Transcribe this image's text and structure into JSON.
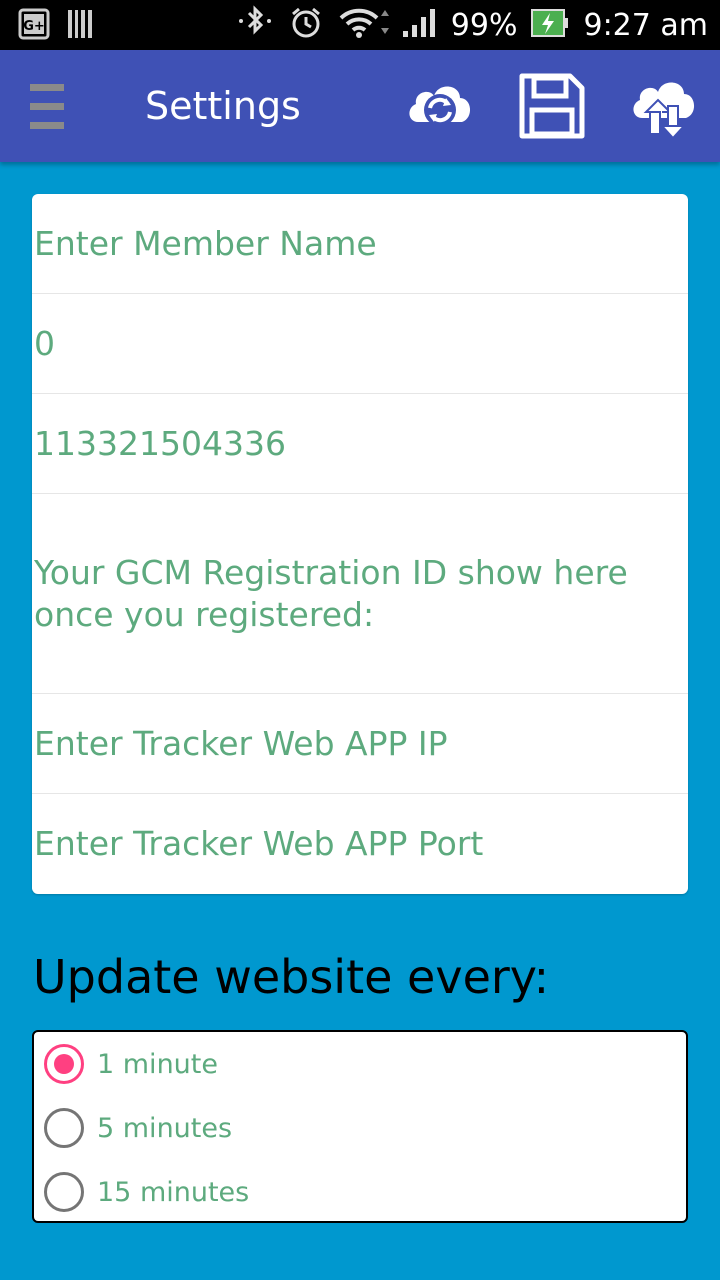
{
  "status_bar": {
    "battery": "99%",
    "time": "9:27 am"
  },
  "app_bar": {
    "title": "Settings"
  },
  "form": {
    "member_name_placeholder": "Enter Member Name",
    "field_2_value": "0",
    "field_3_value": "113321504336",
    "gcm_text": "Your GCM Registration ID show here once you registered:",
    "tracker_ip_placeholder": "Enter Tracker Web APP IP",
    "tracker_port_placeholder": "Enter Tracker Web APP Port"
  },
  "update": {
    "heading": "Update website every:",
    "options": [
      {
        "label": "1 minute",
        "selected": true
      },
      {
        "label": "5 minutes",
        "selected": false
      },
      {
        "label": "15 minutes",
        "selected": false
      }
    ]
  },
  "colors": {
    "app_bar": "#3F51B5",
    "background": "#0098CF",
    "field_text": "#5DAA7E",
    "radio_accent": "#FF4081"
  },
  "icons": [
    "gplus-icon",
    "barcode-icon",
    "bluetooth-icon",
    "alarm-icon",
    "wifi-icon",
    "signal-icon",
    "battery-charging-icon",
    "menu-icon",
    "cloud-sync-icon",
    "save-icon",
    "cloud-upload-download-icon"
  ]
}
